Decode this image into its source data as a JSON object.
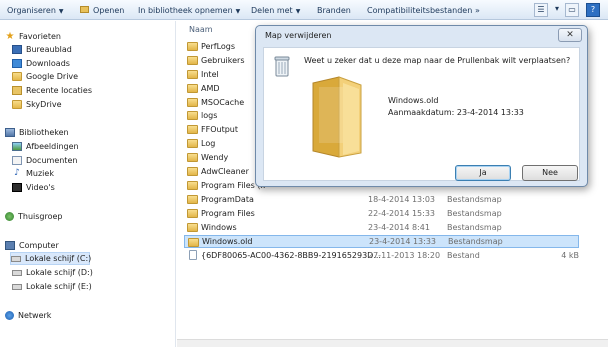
{
  "toolbar": {
    "organize": "Organiseren",
    "open": "Openen",
    "include_in_library": "In bibliotheek opnemen",
    "share_with": "Delen met",
    "burn": "Branden",
    "compatibility_files": "Compatibiliteitsbestanden",
    "more": "»"
  },
  "nav": {
    "favorites": "Favorieten",
    "desktop": "Bureaublad",
    "downloads": "Downloads",
    "google_drive": "Google Drive",
    "recent": "Recente locaties",
    "skydrive": "SkyDrive",
    "libraries": "Bibliotheken",
    "pictures": "Afbeeldingen",
    "documents": "Documenten",
    "music": "Muziek",
    "videos": "Video's",
    "homegroup": "Thuisgroep",
    "computer": "Computer",
    "drive_c": "Lokale schijf (C:)",
    "drive_d": "Lokale schijf (D:)",
    "drive_e": "Lokale schijf (E:)",
    "network": "Netwerk"
  },
  "content": {
    "name_header": "Naam",
    "rows": [
      {
        "name": "PerfLogs",
        "date": "",
        "type": "",
        "size": ""
      },
      {
        "name": "Gebruikers",
        "date": "",
        "type": "",
        "size": ""
      },
      {
        "name": "Intel",
        "date": "",
        "type": "",
        "size": ""
      },
      {
        "name": "AMD",
        "date": "",
        "type": "",
        "size": ""
      },
      {
        "name": "MSOCache",
        "date": "",
        "type": "",
        "size": ""
      },
      {
        "name": "logs",
        "date": "",
        "type": "",
        "size": ""
      },
      {
        "name": "FFOutput",
        "date": "",
        "type": "",
        "size": ""
      },
      {
        "name": "Log",
        "date": "",
        "type": "",
        "size": ""
      },
      {
        "name": "Wendy",
        "date": "",
        "type": "",
        "size": ""
      },
      {
        "name": "AdwCleaner",
        "date": "",
        "type": "",
        "size": ""
      },
      {
        "name": "Program Files (x",
        "date": "",
        "type": "",
        "size": ""
      },
      {
        "name": "ProgramData",
        "date": "18-4-2014 13:03",
        "type": "Bestandsmap",
        "size": ""
      },
      {
        "name": "Program Files",
        "date": "22-4-2014 15:33",
        "type": "Bestandsmap",
        "size": ""
      },
      {
        "name": "Windows",
        "date": "23-4-2014 8:41",
        "type": "Bestandsmap",
        "size": ""
      },
      {
        "name": "Windows.old",
        "date": "23-4-2014 13:33",
        "type": "Bestandsmap",
        "size": ""
      },
      {
        "name": "{6DF80065-AC00-4362-8BB9-219165293D...",
        "date": "27-11-2013 18:20",
        "type": "Bestand",
        "size": "4 kB"
      }
    ]
  },
  "dialog": {
    "title": "Map verwijderen",
    "close": "✕",
    "question": "Weet u zeker dat u deze map naar de Prullenbak wilt verplaatsen?",
    "item_name": "Windows.old",
    "item_date": "Aanmaakdatum: 23-4-2014 13:33",
    "yes": "Ja",
    "no": "Nee"
  }
}
